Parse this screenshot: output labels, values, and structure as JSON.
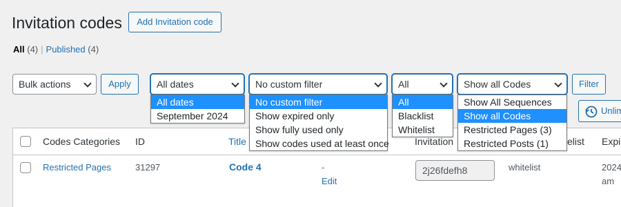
{
  "header": {
    "title": "Invitation codes",
    "add_button": "Add Invitation code"
  },
  "views": {
    "all_label": "All",
    "all_count": "(4)",
    "separator": "|",
    "published_label": "Published",
    "published_count": "(4)"
  },
  "toolbar": {
    "bulk_actions": "Bulk actions",
    "apply": "Apply",
    "dates_filter": "All dates",
    "custom_filter": "No custom filter",
    "list_filter": "All",
    "codes_filter": "Show all Codes",
    "filter_button": "Filter",
    "unlimited_button": "Unlim"
  },
  "dropdowns": {
    "dates": [
      "All dates",
      "September 2024"
    ],
    "custom": [
      "No custom filter",
      "Show expired only",
      "Show fully used only",
      "Show codes used at least once"
    ],
    "list": [
      "All",
      "Blacklist",
      "Whitelist"
    ],
    "codes": [
      "Show All Sequences",
      "Show all Codes",
      "Restricted Pages  (3)",
      "Restricted Posts  (1)"
    ]
  },
  "table": {
    "columns": {
      "categories": "Codes Categories",
      "id": "ID",
      "title": "Title",
      "invitation": "Invitation",
      "list": "elist",
      "expires": "Expir"
    },
    "row": {
      "category": "Restricted Pages",
      "id": "31297",
      "title": "Code 4",
      "dash": "-",
      "edit": "Edit",
      "code": "2j26fdefh8",
      "list": "whitelist",
      "expires_line1": "2024",
      "expires_line2": "am"
    }
  }
}
